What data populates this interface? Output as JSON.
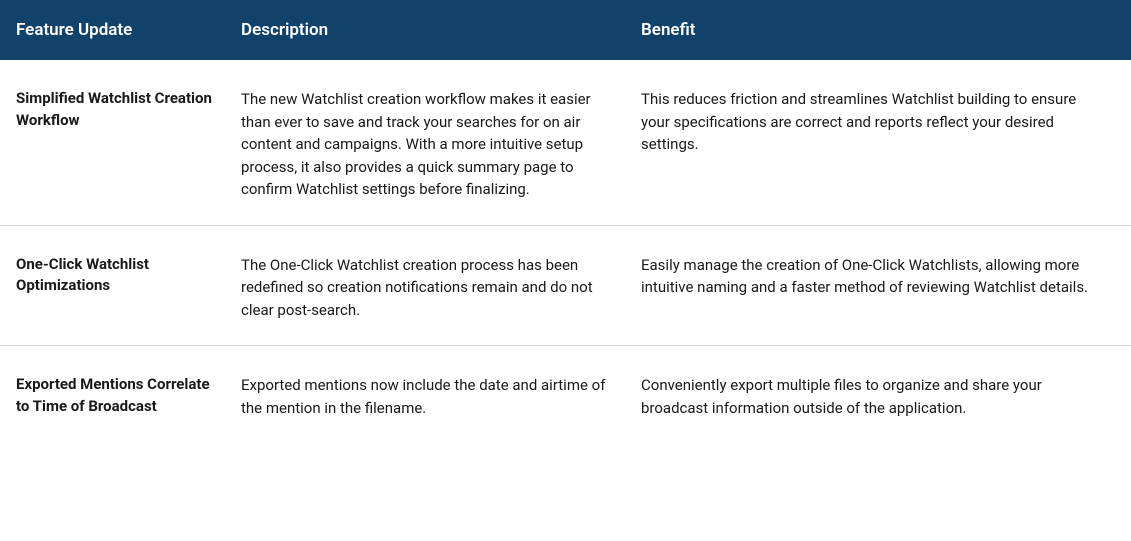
{
  "headers": {
    "feature": "Feature Update",
    "description": "Description",
    "benefit": "Benefit"
  },
  "rows": [
    {
      "feature": "Simplified Watchlist Creation Workflow",
      "description": "The new Watchlist creation workflow makes it easier than ever to save and track your searches for on air content and campaigns. With a more intuitive setup process, it also provides a quick summary page to confirm Watchlist settings before finalizing.",
      "benefit": "This reduces friction and streamlines Watchlist building to ensure your specifications are correct and reports reflect your desired settings."
    },
    {
      "feature": "One-Click Watchlist Optimizations",
      "description": "The One-Click Watchlist creation process has been redefined so creation notifications remain and do not clear post-search.",
      "benefit": "Easily manage the creation of One-Click Watchlists, allowing more intuitive naming and a faster method of reviewing Watchlist details."
    },
    {
      "feature": "Exported Mentions Correlate to Time of Broadcast",
      "description": "Exported mentions now include the date and airtime of the mention in the filename.",
      "benefit": "Conveniently export multiple files to organize and share your broadcast information outside of the application."
    }
  ]
}
